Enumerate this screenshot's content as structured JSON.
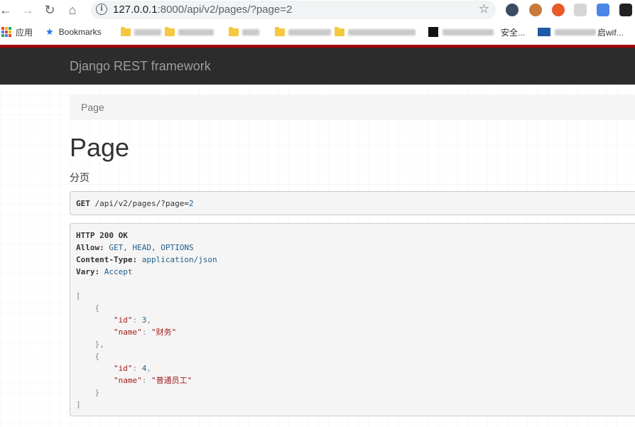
{
  "browser": {
    "url_host": "127.0.0.1",
    "url_path": ":8000/api/v2/pages/?page=2",
    "bookmarks": {
      "apps_label": "应用",
      "bookmarks_label": "Bookmarks",
      "partial_1": "安全...",
      "partial_2": "启wif..."
    }
  },
  "navbar": {
    "brand": "Django REST framework"
  },
  "breadcrumb": {
    "current": "Page"
  },
  "page": {
    "title": "Page",
    "description": "分页"
  },
  "request": {
    "method": "GET",
    "path": "/api/v2/pages/?page=",
    "page_value": "2"
  },
  "response": {
    "status_line": "HTTP 200 OK",
    "headers": [
      {
        "name": "Allow:",
        "value": "GET, HEAD, OPTIONS"
      },
      {
        "name": "Content-Type:",
        "value": "application/json"
      },
      {
        "name": "Vary:",
        "value": "Accept"
      }
    ],
    "items": [
      {
        "id": "3",
        "name": "\"财务\""
      },
      {
        "id": "4",
        "name": "\"普通员工\""
      }
    ],
    "keys": {
      "id": "\"id\"",
      "name": "\"name\""
    }
  }
}
